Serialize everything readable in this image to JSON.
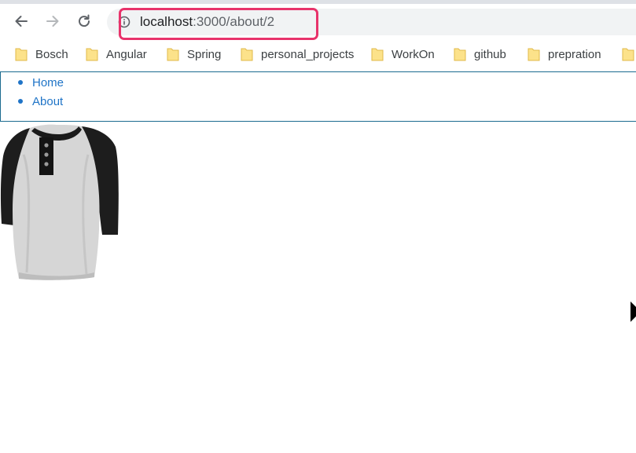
{
  "browser": {
    "url_host": "localhost",
    "url_path": ":3000/about/2",
    "icons": {
      "back": "arrow-left-icon",
      "forward": "arrow-right-icon",
      "reload": "reload-icon",
      "info": "info-icon",
      "folder": "folder-icon"
    },
    "highlight_color": "#e8336b"
  },
  "bookmarks": [
    {
      "label": "Bosch"
    },
    {
      "label": "Angular"
    },
    {
      "label": "Spring"
    },
    {
      "label": "personal_projects"
    },
    {
      "label": "WorkOn"
    },
    {
      "label": "github"
    },
    {
      "label": "prepration"
    }
  ],
  "page": {
    "nav": [
      {
        "label": "Home"
      },
      {
        "label": "About"
      }
    ],
    "link_color": "#1f74c7",
    "product_image": "raglan-henley-tshirt"
  }
}
